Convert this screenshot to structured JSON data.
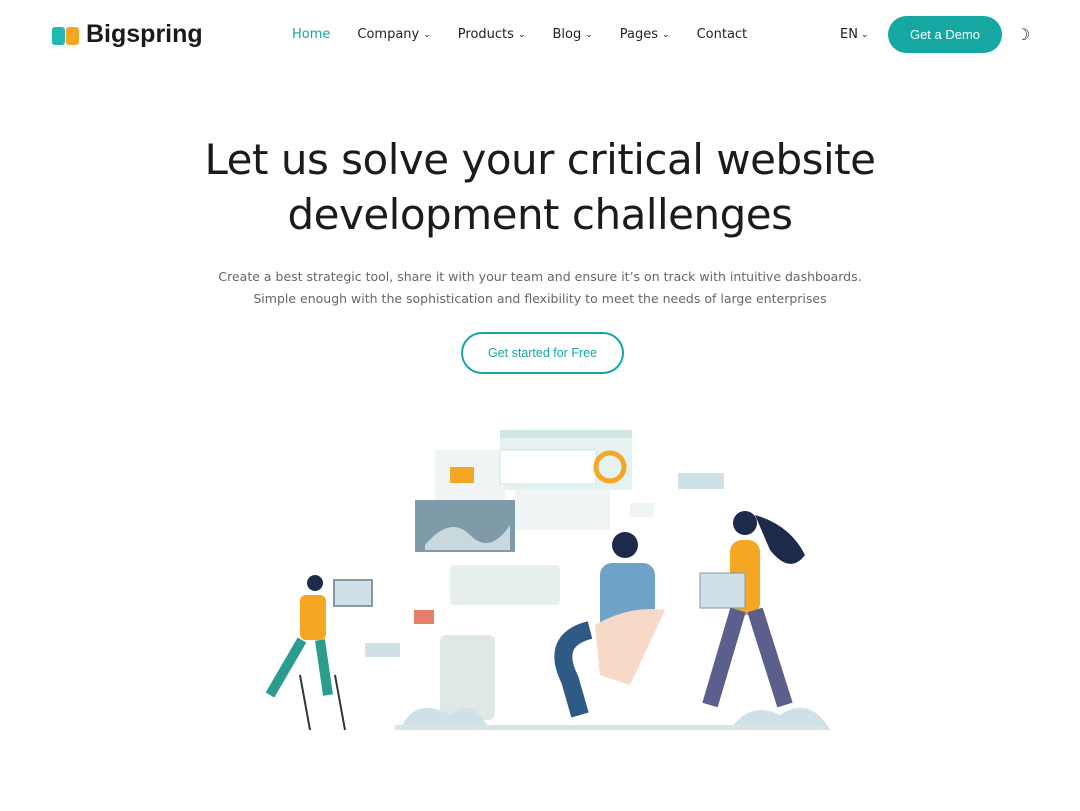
{
  "header": {
    "logo_text": "Bigspring",
    "nav": [
      {
        "label": "Home",
        "active": true,
        "dropdown": false
      },
      {
        "label": "Company",
        "dropdown": true
      },
      {
        "label": "Products",
        "dropdown": true
      },
      {
        "label": "Blog",
        "dropdown": true
      },
      {
        "label": "Pages",
        "dropdown": true
      },
      {
        "label": "Contact",
        "dropdown": false
      }
    ],
    "language": "EN",
    "demo_label": "Get a Demo",
    "theme_icon": "moon-icon"
  },
  "hero": {
    "title_line1": "Let us solve your critical website",
    "title_line2": "development challenges",
    "subtitle_line1": "Create a best strategic tool, share it with your team and ensure it’s on track with intuitive dashboards.",
    "subtitle_line2": "Simple enough with the sophistication and flexibility to meet the needs of large enterprises",
    "cta_label": "Get started for Free"
  },
  "colors": {
    "accent": "#16a7a2",
    "logo_orange": "#f5a623",
    "logo_teal": "#1fb8b3"
  }
}
